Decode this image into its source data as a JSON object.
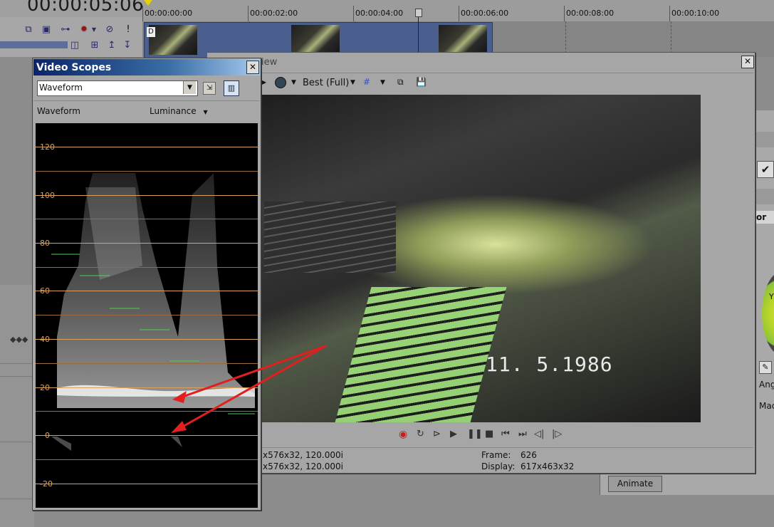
{
  "editor": {
    "timecode": "00:00:05:06",
    "ruler_ticks": [
      "00:00:00:00",
      "00:00:02:00",
      "00:00:04:00",
      "00:00:06:00",
      "00:00:08:00",
      "00:00:10:00"
    ],
    "clip_marker": "D"
  },
  "preview": {
    "title_partial": "iew",
    "quality": "Best (Full)",
    "video_overlay_date": "11. 5.1986",
    "status": {
      "project_line": "x576x32, 120.000i",
      "preview_line": "x576x32, 120.000i",
      "frame_label": "Frame:",
      "frame_value": "626",
      "display_label": "Display:",
      "display_value": "617x463x32"
    },
    "transport_icons": [
      "record-icon",
      "loop-icon",
      "play-from-start-icon",
      "play-icon",
      "pause-icon",
      "stop-icon",
      "previous-frame-icon",
      "next-frame-icon",
      "previous-marker-icon",
      "next-marker-icon"
    ]
  },
  "scopes": {
    "title": "Video Scopes",
    "scope_type": "Waveform",
    "mode_label": "Waveform",
    "channel_label": "Luminance",
    "y_axis_labels": [
      "120",
      "100",
      "80",
      "60",
      "40",
      "20",
      "0",
      "-20"
    ]
  },
  "right_panel": {
    "animate_label": "Animate",
    "or_label": "or",
    "wheel_label": "Y",
    "ang_label": "Ang",
    "mac_label": "Mac"
  },
  "colors": {
    "scope_grid": "#d8a160",
    "scope_bg": "#000000",
    "title_bar": "#0a246a",
    "annotation_arrow": "#e21f1f"
  }
}
